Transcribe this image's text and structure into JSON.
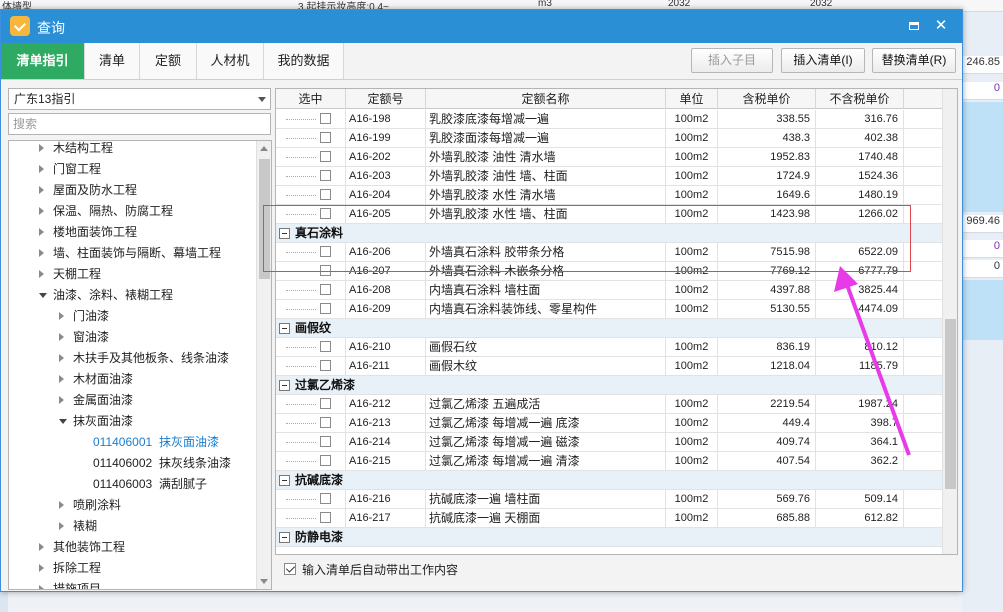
{
  "background": {
    "top_texts": [
      "体墙型",
      "3.起挂示妆高度:0.4~",
      "m3",
      "2032",
      "2032"
    ],
    "right_values": [
      "246.85",
      "0",
      "969.46",
      "0",
      "0"
    ]
  },
  "dialog": {
    "title": "查询",
    "tabs": [
      "清单指引",
      "清单",
      "定额",
      "人材机",
      "我的数据"
    ],
    "buttons": {
      "insert_child": "插入子目",
      "insert_list": "插入清单(I)",
      "replace_list": "替换清单(R)"
    }
  },
  "left": {
    "combo_value": "广东13指引",
    "search_placeholder": "搜索",
    "tree": [
      {
        "label": "木结构工程",
        "level": 1,
        "state": "collapsed"
      },
      {
        "label": "门窗工程",
        "level": 1,
        "state": "collapsed"
      },
      {
        "label": "屋面及防水工程",
        "level": 1,
        "state": "collapsed"
      },
      {
        "label": "保温、隔热、防腐工程",
        "level": 1,
        "state": "collapsed"
      },
      {
        "label": "楼地面装饰工程",
        "level": 1,
        "state": "collapsed"
      },
      {
        "label": "墙、柱面装饰与隔断、幕墙工程",
        "level": 1,
        "state": "collapsed"
      },
      {
        "label": "天棚工程",
        "level": 1,
        "state": "collapsed"
      },
      {
        "label": "油漆、涂料、裱糊工程",
        "level": 1,
        "state": "expanded"
      },
      {
        "label": "门油漆",
        "level": 2,
        "state": "collapsed"
      },
      {
        "label": "窗油漆",
        "level": 2,
        "state": "collapsed"
      },
      {
        "label": "木扶手及其他板条、线条油漆",
        "level": 2,
        "state": "collapsed"
      },
      {
        "label": "木材面油漆",
        "level": 2,
        "state": "collapsed"
      },
      {
        "label": "金属面油漆",
        "level": 2,
        "state": "collapsed"
      },
      {
        "label": "抹灰面油漆",
        "level": 2,
        "state": "expanded"
      },
      {
        "code": "011406001",
        "label": "抹灰面油漆",
        "level": 3,
        "state": "leaf",
        "selected": true
      },
      {
        "code": "011406002",
        "label": "抹灰线条油漆",
        "level": 3,
        "state": "leaf"
      },
      {
        "code": "011406003",
        "label": "满刮腻子",
        "level": 3,
        "state": "leaf"
      },
      {
        "label": "喷刷涂料",
        "level": 2,
        "state": "collapsed"
      },
      {
        "label": "裱糊",
        "level": 2,
        "state": "collapsed"
      },
      {
        "label": "其他装饰工程",
        "level": 1,
        "state": "collapsed"
      },
      {
        "label": "拆除工程",
        "level": 1,
        "state": "collapsed"
      },
      {
        "label": "措施项目",
        "level": 1,
        "state": "collapsed"
      }
    ]
  },
  "grid": {
    "columns": [
      "选中",
      "定额号",
      "定额名称",
      "单位",
      "含税单价",
      "不含税单价"
    ],
    "rows": [
      {
        "type": "item",
        "code": "A16-198",
        "name": "乳胶漆底漆每增减一遍",
        "unit": "100m2",
        "tax": "338.55",
        "notax": "316.76"
      },
      {
        "type": "item",
        "code": "A16-199",
        "name": "乳胶漆面漆每增减一遍",
        "unit": "100m2",
        "tax": "438.3",
        "notax": "402.38"
      },
      {
        "type": "item",
        "code": "A16-202",
        "name": "外墙乳胶漆 油性 清水墙",
        "unit": "100m2",
        "tax": "1952.83",
        "notax": "1740.48"
      },
      {
        "type": "item",
        "code": "A16-203",
        "name": "外墙乳胶漆 油性 墙、柱面",
        "unit": "100m2",
        "tax": "1724.9",
        "notax": "1524.36"
      },
      {
        "type": "item",
        "code": "A16-204",
        "name": "外墙乳胶漆 水性 清水墙",
        "unit": "100m2",
        "tax": "1649.6",
        "notax": "1480.19"
      },
      {
        "type": "item",
        "code": "A16-205",
        "name": "外墙乳胶漆 水性 墙、柱面",
        "unit": "100m2",
        "tax": "1423.98",
        "notax": "1266.02"
      },
      {
        "type": "group",
        "label": "真石涂料"
      },
      {
        "type": "item",
        "code": "A16-206",
        "name": "外墙真石涂料 胶带条分格",
        "unit": "100m2",
        "tax": "7515.98",
        "notax": "6522.09"
      },
      {
        "type": "item",
        "code": "A16-207",
        "name": "外墙真石涂料 木嵌条分格",
        "unit": "100m2",
        "tax": "7769.12",
        "notax": "6777.79"
      },
      {
        "type": "item",
        "code": "A16-208",
        "name": "内墙真石涂料 墙柱面",
        "unit": "100m2",
        "tax": "4397.88",
        "notax": "3825.44"
      },
      {
        "type": "item",
        "code": "A16-209",
        "name": "内墙真石涂料装饰线、零星构件",
        "unit": "100m2",
        "tax": "5130.55",
        "notax": "4474.09"
      },
      {
        "type": "group",
        "label": "画假纹"
      },
      {
        "type": "item",
        "code": "A16-210",
        "name": "画假石纹",
        "unit": "100m2",
        "tax": "836.19",
        "notax": "810.12"
      },
      {
        "type": "item",
        "code": "A16-211",
        "name": "画假木纹",
        "unit": "100m2",
        "tax": "1218.04",
        "notax": "1185.79"
      },
      {
        "type": "group",
        "label": "过氯乙烯漆"
      },
      {
        "type": "item",
        "code": "A16-212",
        "name": "过氯乙烯漆 五遍成活",
        "unit": "100m2",
        "tax": "2219.54",
        "notax": "1987.24"
      },
      {
        "type": "item",
        "code": "A16-213",
        "name": "过氯乙烯漆 每增减一遍 底漆",
        "unit": "100m2",
        "tax": "449.4",
        "notax": "398.7"
      },
      {
        "type": "item",
        "code": "A16-214",
        "name": "过氯乙烯漆 每增减一遍 磁漆",
        "unit": "100m2",
        "tax": "409.74",
        "notax": "364.1"
      },
      {
        "type": "item",
        "code": "A16-215",
        "name": "过氯乙烯漆 每增减一遍 清漆",
        "unit": "100m2",
        "tax": "407.54",
        "notax": "362.2"
      },
      {
        "type": "group",
        "label": "抗碱底漆"
      },
      {
        "type": "item",
        "code": "A16-216",
        "name": "抗碱底漆一遍 墙柱面",
        "unit": "100m2",
        "tax": "569.76",
        "notax": "509.14"
      },
      {
        "type": "item",
        "code": "A16-217",
        "name": "抗碱底漆一遍 天棚面",
        "unit": "100m2",
        "tax": "685.88",
        "notax": "612.82"
      },
      {
        "type": "group",
        "label": "防静电漆"
      }
    ]
  },
  "footer": {
    "auto_bring_label": "输入清单后自动带出工作内容"
  },
  "colors": {
    "title_bar": "#2b8fd6",
    "active_tab": "#2eaa63",
    "highlight_box": "#e0474c",
    "arrow": "#e83ae8"
  }
}
